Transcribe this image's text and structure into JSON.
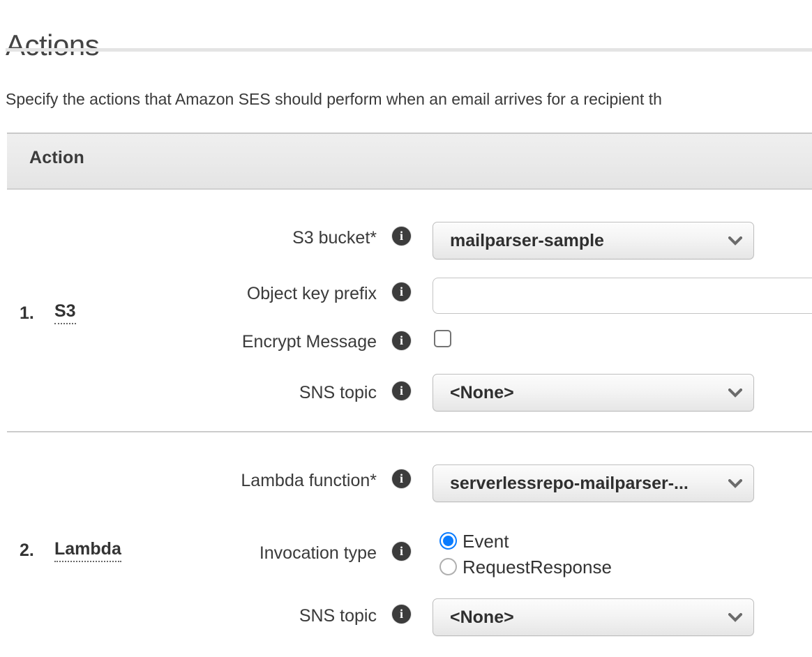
{
  "page": {
    "title": "Actions",
    "description": "Specify the actions that Amazon SES should perform when an email arrives for a recipient th"
  },
  "table": {
    "header": "Action"
  },
  "icons": {
    "info": "info-icon",
    "chevron_down": "chevron-down-icon"
  },
  "actions": [
    {
      "index": "1.",
      "name": "S3",
      "fields": [
        {
          "label": "S3 bucket*",
          "control": "select",
          "value": "mailparser-sample"
        },
        {
          "label": "Object key prefix",
          "control": "text",
          "value": "",
          "placeholder": ""
        },
        {
          "label": "Encrypt Message",
          "control": "checkbox",
          "checked": false
        },
        {
          "label": "SNS topic",
          "control": "select",
          "value": "<None>"
        }
      ]
    },
    {
      "index": "2.",
      "name": "Lambda",
      "fields": [
        {
          "label": "Lambda function*",
          "control": "select",
          "value": "serverlessrepo-mailparser-..."
        },
        {
          "label": "Invocation type",
          "control": "radio",
          "options": [
            {
              "label": "Event",
              "selected": true
            },
            {
              "label": "RequestResponse",
              "selected": false
            }
          ]
        },
        {
          "label": "SNS topic",
          "control": "select",
          "value": "<None>"
        }
      ]
    }
  ],
  "colors": {
    "accent_blue": "#0a7cff",
    "text": "#333333",
    "rule": "#e4e4e4",
    "band": "#eaeaea"
  }
}
